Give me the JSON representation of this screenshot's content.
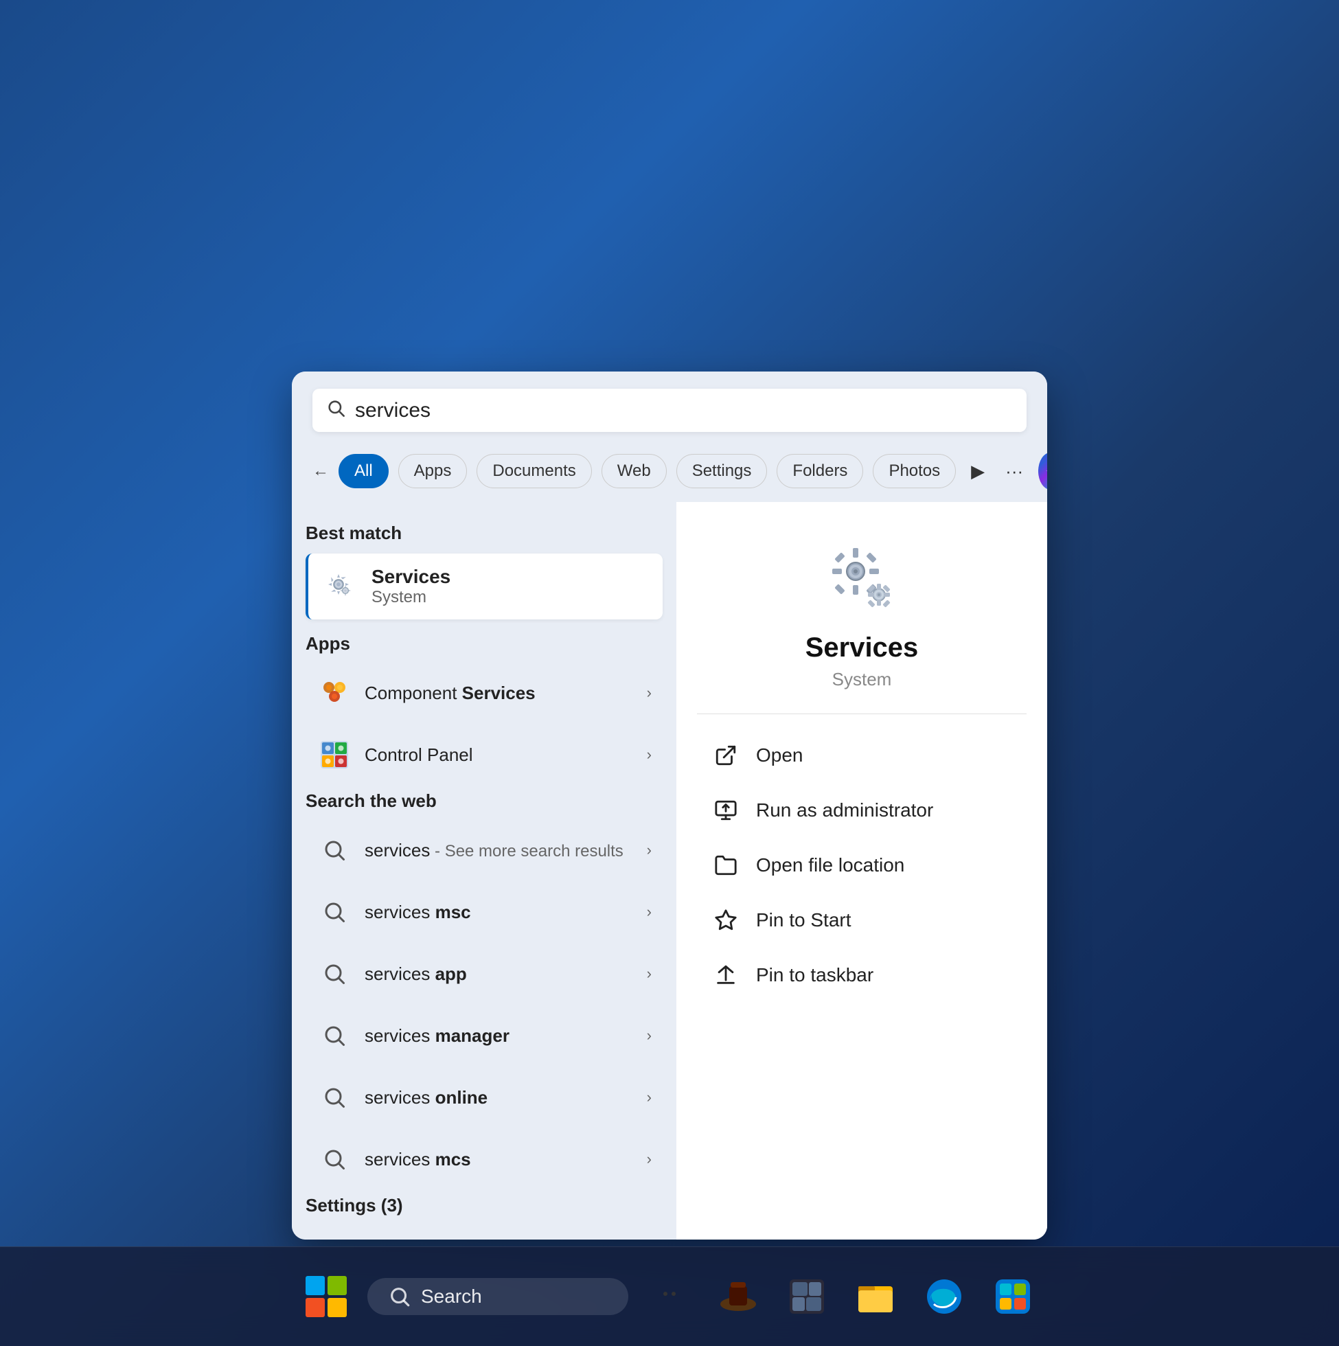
{
  "search": {
    "query": "services",
    "placeholder": "Search"
  },
  "filter_tabs": {
    "back_label": "←",
    "tabs": [
      {
        "id": "all",
        "label": "All",
        "active": true
      },
      {
        "id": "apps",
        "label": "Apps",
        "active": false
      },
      {
        "id": "documents",
        "label": "Documents",
        "active": false
      },
      {
        "id": "web",
        "label": "Web",
        "active": false
      },
      {
        "id": "settings",
        "label": "Settings",
        "active": false
      },
      {
        "id": "folders",
        "label": "Folders",
        "active": false
      },
      {
        "id": "photos",
        "label": "Photos",
        "active": false
      }
    ],
    "more_icon": "▶",
    "ellipsis": "···"
  },
  "best_match": {
    "section_label": "Best match",
    "item": {
      "title": "Services",
      "subtitle": "System"
    }
  },
  "apps_section": {
    "section_label": "Apps",
    "items": [
      {
        "label_plain": "Component ",
        "label_bold": "Services",
        "has_chevron": true
      },
      {
        "label_plain": "Control Panel",
        "label_bold": "",
        "has_chevron": true
      }
    ]
  },
  "web_section": {
    "section_label": "Search the web",
    "items": [
      {
        "query_plain": "services",
        "query_suffix": " - See more search results",
        "has_chevron": true
      },
      {
        "query_plain": "services ",
        "query_bold": "msc",
        "has_chevron": true
      },
      {
        "query_plain": "services ",
        "query_bold": "app",
        "has_chevron": true
      },
      {
        "query_plain": "services ",
        "query_bold": "manager",
        "has_chevron": true
      },
      {
        "query_plain": "services ",
        "query_bold": "online",
        "has_chevron": true
      },
      {
        "query_plain": "services ",
        "query_bold": "mcs",
        "has_chevron": true
      }
    ]
  },
  "settings_section": {
    "section_label": "Settings (3)"
  },
  "detail_panel": {
    "title": "Services",
    "subtitle": "System",
    "actions": [
      {
        "id": "open",
        "label": "Open"
      },
      {
        "id": "run-as-admin",
        "label": "Run as administrator"
      },
      {
        "id": "open-file-location",
        "label": "Open file location"
      },
      {
        "id": "pin-start",
        "label": "Pin to Start"
      },
      {
        "id": "pin-taskbar",
        "label": "Pin to taskbar"
      }
    ]
  },
  "taskbar": {
    "search_label": "Search"
  }
}
